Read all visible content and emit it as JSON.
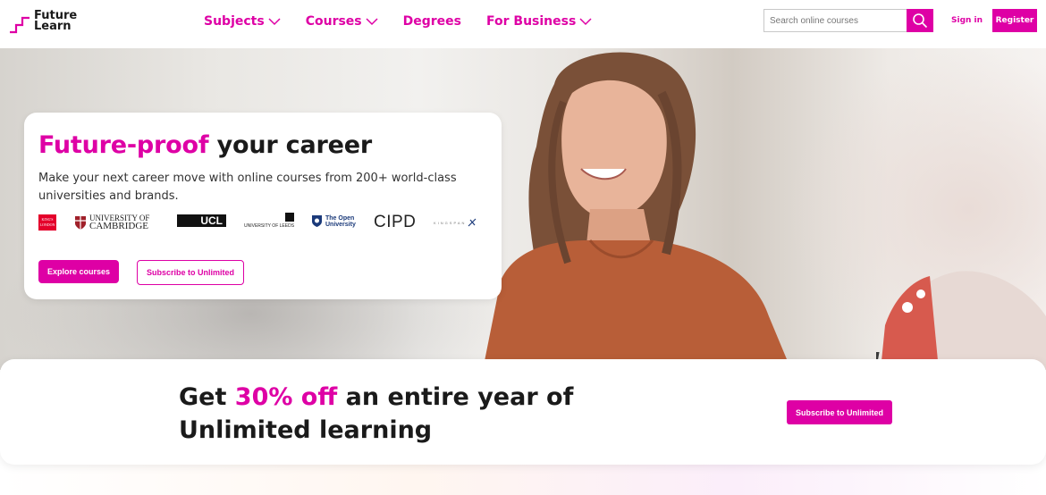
{
  "brand": {
    "line1": "Future",
    "line2": "Learn",
    "accent": "#de00a5"
  },
  "nav": [
    {
      "label": "Subjects",
      "has_dropdown": true
    },
    {
      "label": "Courses",
      "has_dropdown": true
    },
    {
      "label": "Degrees",
      "has_dropdown": false
    },
    {
      "label": "For Business",
      "has_dropdown": true
    }
  ],
  "search": {
    "placeholder": "Search online courses",
    "icon": "search-icon"
  },
  "auth": {
    "sign_in": "Sign in",
    "register": "Register"
  },
  "hero": {
    "title_highlight": "Future-proof",
    "title_rest": " your career",
    "subtitle": "Make your next career move with online courses from 200+ world-class universities and brands.",
    "partner_logos": [
      "King's College London",
      "University of Cambridge",
      "UCL",
      "University of Leeds",
      "The Open University",
      "CIPD",
      "Kingspan"
    ],
    "logo_text": {
      "kings_line1": "KING'S",
      "kings_line2": "LONDON",
      "cambridge_line1": "UNIVERSITY OF",
      "cambridge_line2": "CAMBRIDGE",
      "ucl": "UCL",
      "leeds": "UNIVERSITY OF LEEDS",
      "open_line1": "The Open",
      "open_line2": "University",
      "cipd": "CIPD",
      "kingspan": "KINGSPAN"
    },
    "primary_cta": "Explore courses",
    "secondary_cta": "Subscribe to Unlimited"
  },
  "promo": {
    "line1_start": "Get ",
    "line1_highlight": "30% off",
    "line1_end": " an entire year of",
    "line2": "Unlimited learning",
    "cta": "Subscribe to Unlimited"
  }
}
